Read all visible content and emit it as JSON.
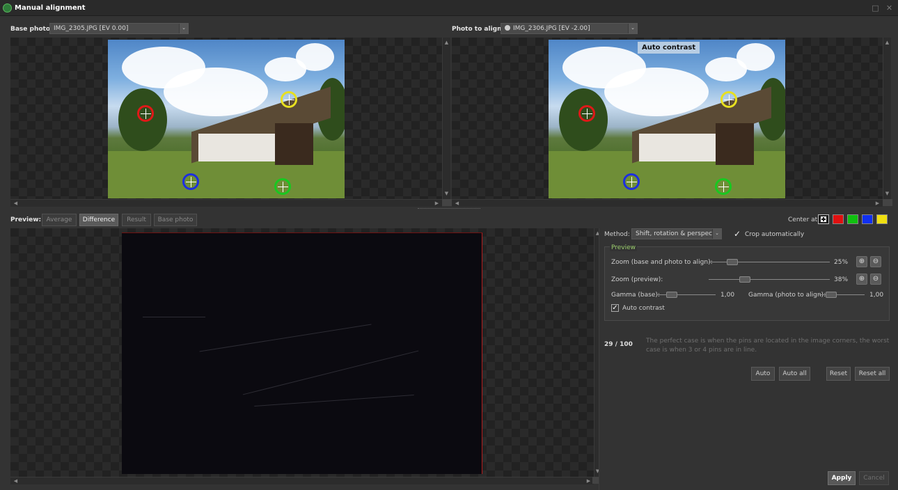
{
  "window": {
    "title": "Manual alignment",
    "maximize_glyph": "□",
    "close_glyph": "✕"
  },
  "base_photo": {
    "label": "Base photo:",
    "value": "IMG_2305.JPG [EV 0.00]"
  },
  "photo_to_align": {
    "label": "Photo to align:",
    "value": "IMG_2306.JPG [EV -2.00]"
  },
  "overlay": {
    "auto_contrast": "Auto contrast"
  },
  "preview": {
    "label": "Preview:",
    "tabs": [
      {
        "label": "Average",
        "active": false
      },
      {
        "label": "Difference",
        "active": true
      },
      {
        "label": "Result",
        "active": false
      },
      {
        "label": "Base photo",
        "active": false
      }
    ]
  },
  "center_at": {
    "label": "Center at:",
    "options": [
      "center",
      "red",
      "green",
      "blue",
      "yellow"
    ],
    "colors": {
      "red": "#e01010",
      "green": "#10c010",
      "blue": "#1030f0",
      "yellow": "#f0e010"
    }
  },
  "pins": {
    "colors": {
      "red": "#e01818",
      "yellow": "#e8e020",
      "blue": "#1c2ee0",
      "green": "#18c820"
    }
  },
  "method": {
    "label": "Method:",
    "value": "Shift, rotation & perspective"
  },
  "crop": {
    "label": "Crop automatically",
    "checked": true
  },
  "preview_group": {
    "title": "Preview",
    "zoom_base": {
      "label": "Zoom (base and photo to align):",
      "value": "25%",
      "level": 0.25
    },
    "zoom_preview": {
      "label": "Zoom (preview):",
      "value": "38%",
      "level": 0.38
    },
    "gamma_base": {
      "label": "Gamma (base):",
      "value": "1,00"
    },
    "gamma_align": {
      "label": "Gamma (photo to align):",
      "value": "1,00"
    },
    "auto_contrast": {
      "label": "Auto contrast",
      "checked": true
    }
  },
  "score": {
    "value": "29 / 100",
    "hint": "The perfect case is when the pins are located in the image corners, the worst case is when 3 or 4 pins are in line."
  },
  "buttons": {
    "auto": "Auto",
    "auto_all": "Auto all",
    "reset": "Reset",
    "reset_all": "Reset all",
    "apply": "Apply",
    "cancel": "Cancel"
  },
  "icons": {
    "zoom_in": "zoom-in-icon",
    "zoom_out": "zoom-out-icon",
    "checkmark": "✓",
    "dropdown": "⌄"
  }
}
